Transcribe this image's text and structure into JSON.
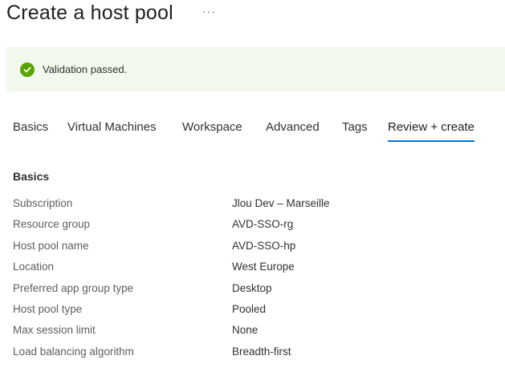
{
  "header": {
    "title": "Create a host pool",
    "more_label": "···"
  },
  "banner": {
    "status": "success",
    "icon": "check-circle-icon",
    "text": "Validation passed.",
    "color": "#57a300",
    "background": "#f1f8ec"
  },
  "tabs": [
    {
      "label": "Basics"
    },
    {
      "label": "Virtual Machines"
    },
    {
      "label": "Workspace"
    },
    {
      "label": "Advanced"
    },
    {
      "label": "Tags"
    },
    {
      "label": "Review + create",
      "active": true
    }
  ],
  "accent_color": "#0078d4",
  "section": {
    "heading": "Basics",
    "rows": [
      {
        "label": "Subscription",
        "value": "Jlou Dev – Marseille"
      },
      {
        "label": "Resource group",
        "value": "AVD-SSO-rg"
      },
      {
        "label": "Host pool name",
        "value": "AVD-SSO-hp"
      },
      {
        "label": "Location",
        "value": "West Europe"
      },
      {
        "label": "Preferred app group type",
        "value": "Desktop"
      },
      {
        "label": "Host pool type",
        "value": "Pooled"
      },
      {
        "label": "Max session limit",
        "value": "None"
      },
      {
        "label": "Load balancing algorithm",
        "value": "Breadth-first"
      }
    ]
  }
}
